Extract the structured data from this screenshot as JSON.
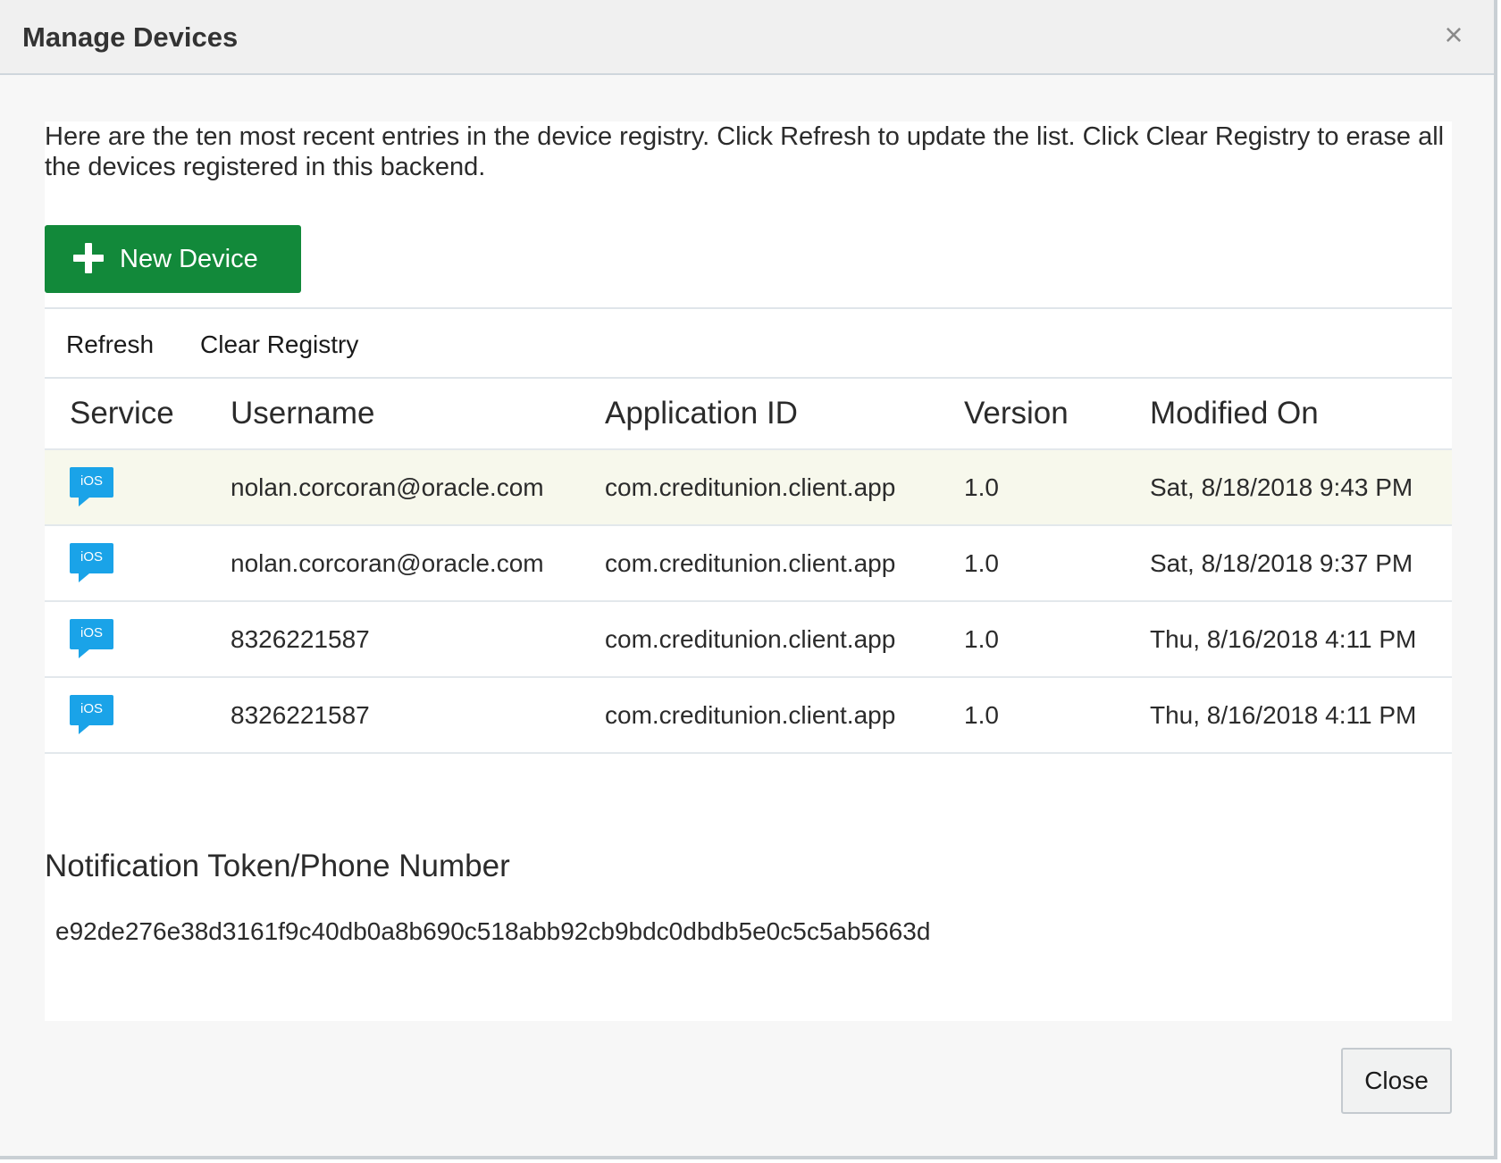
{
  "dialog": {
    "title": "Manage Devices",
    "close_icon": "close-x-icon"
  },
  "intro_text": "Here are the ten most recent entries in the device registry. Click Refresh to update the list. Click Clear Registry to erase all the devices registered in this backend.",
  "new_device_button": {
    "label": "New Device",
    "icon": "plus-icon",
    "color": "#12893a"
  },
  "toolbar": {
    "refresh_label": "Refresh",
    "clear_label": "Clear Registry"
  },
  "table": {
    "headers": [
      "Service",
      "Username",
      "Application ID",
      "Version",
      "Modified On"
    ],
    "rows": [
      {
        "service": "iOS",
        "username": "nolan.corcoran@oracle.com",
        "app_id": "com.creditunion.client.app",
        "version": "1.0",
        "modified": "Sat, 8/18/2018 9:43 PM",
        "selected": true
      },
      {
        "service": "iOS",
        "username": "nolan.corcoran@oracle.com",
        "app_id": "com.creditunion.client.app",
        "version": "1.0",
        "modified": "Sat, 8/18/2018 9:37 PM",
        "selected": false
      },
      {
        "service": "iOS",
        "username": "8326221587",
        "app_id": "com.creditunion.client.app",
        "version": "1.0",
        "modified": "Thu, 8/16/2018 4:11 PM",
        "selected": false
      },
      {
        "service": "iOS",
        "username": "8326221587",
        "app_id": "com.creditunion.client.app",
        "version": "1.0",
        "modified": "Thu, 8/16/2018 4:11 PM",
        "selected": false
      }
    ]
  },
  "token_section": {
    "title": "Notification Token/Phone Number",
    "value": "e92de276e38d3161f9c40db0a8b690c518abb92cb9bdc0dbdb5e0c5c5ab5663d"
  },
  "footer": {
    "close_label": "Close"
  },
  "colors": {
    "ios_badge": "#1aa3e8",
    "selected_row": "#f7f8ec"
  }
}
